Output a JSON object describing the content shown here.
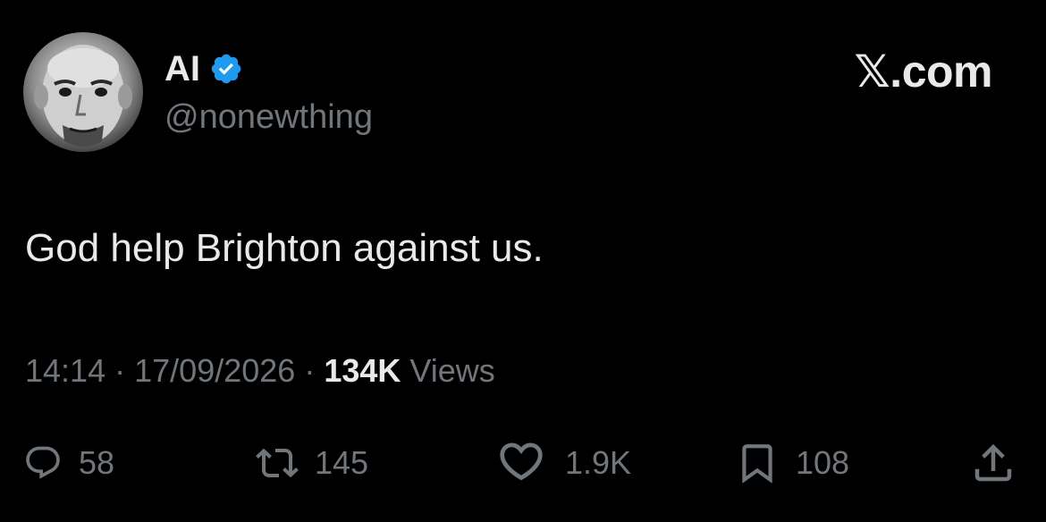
{
  "author": {
    "display_name": "AI",
    "handle": "@nonewthing",
    "verified_color": "#1d9bf0"
  },
  "brand": "𝕏.com",
  "tweet": {
    "text": "God help Brighton against us."
  },
  "meta": {
    "time": "14:14",
    "separator": "·",
    "date": "17/09/2026",
    "views_count": "134K",
    "views_label": "Views"
  },
  "actions": {
    "replies": "58",
    "reposts": "145",
    "likes": "1.9K",
    "bookmarks": "108"
  },
  "icons": {
    "reply": "reply-icon",
    "repost": "repost-icon",
    "like": "heart-icon",
    "bookmark": "bookmark-icon",
    "share": "share-icon",
    "verified": "verified-badge-icon"
  },
  "colors": {
    "background": "#000000",
    "primary_text": "#e7e9ea",
    "secondary_text": "#71767b",
    "accent": "#1d9bf0"
  }
}
